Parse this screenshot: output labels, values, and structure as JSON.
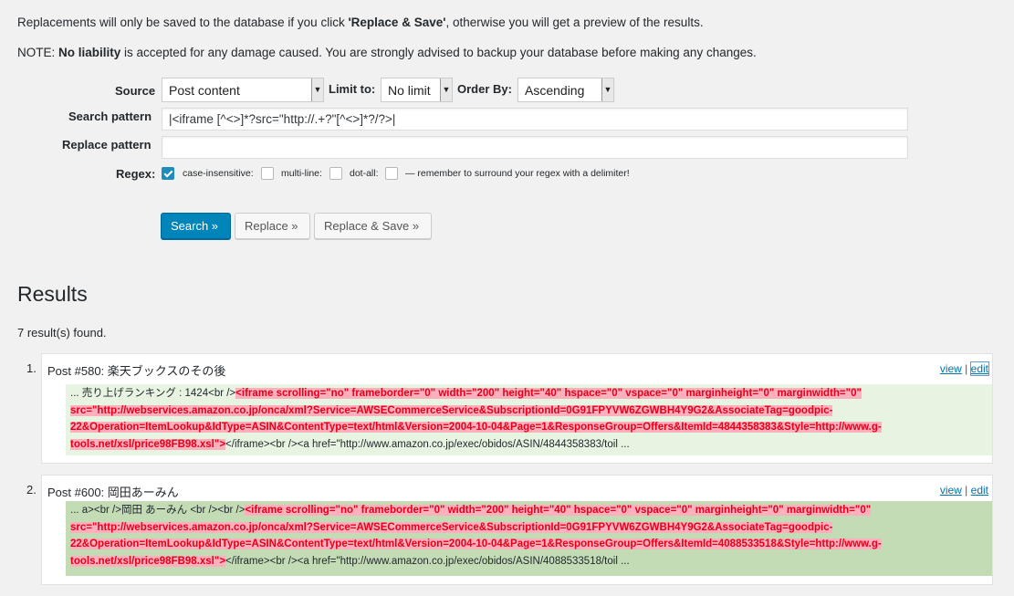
{
  "intro": {
    "line1_pre": "Replacements will only be saved to the database if you click ",
    "line1_bold": "'Replace & Save'",
    "line1_post": ", otherwise you will get a preview of the results.",
    "line2_pre": "NOTE: ",
    "line2_bold": "No liability",
    "line2_post": " is accepted for any damage caused. You are strongly advised to backup your database before making any changes."
  },
  "form": {
    "source_label": "Source",
    "source_value": "Post content",
    "limit_label": "Limit to:",
    "limit_value": "No limit",
    "order_label": "Order By:",
    "order_value": "Ascending",
    "search_label": "Search pattern",
    "search_value": "|<iframe [^<>]*?src=\"http://.+?\"[^<>]*?/?>|",
    "replace_label": "Replace pattern",
    "replace_value": "",
    "regex_label": "Regex:",
    "regex_checked": true,
    "case_insensitive_label": "case-insensitive:",
    "multi_line_label": "multi-line:",
    "dot_all_label": "dot-all:",
    "delimiter_note": "— remember to surround your regex with a delimiter!"
  },
  "buttons": {
    "search": "Search »",
    "replace": "Replace »",
    "replace_save": "Replace & Save »"
  },
  "results": {
    "heading": "Results",
    "count": "7 result(s) found.",
    "items": [
      {
        "num": "1.",
        "title": "Post #580: 楽天ブックスのその後",
        "view": "view",
        "sep": "|",
        "edit": "edit",
        "before": "... 売り上げランキング : 1424<br />",
        "match": "<iframe scrolling=\"no\" frameborder=\"0\" width=\"200\" height=\"40\" hspace=\"0\" vspace=\"0\" marginheight=\"0\" marginwidth=\"0\" src=\"http://webservices.amazon.co.jp/onca/xml?Service=AWSECommerceService&SubscriptionId=0G91FPYVW6ZGWBH4Y9G2&AssociateTag=goodpic-22&Operation=ItemLookup&IdType=ASIN&ContentType=text/html&Version=2004-10-04&Page=1&ResponseGroup=Offers&ItemId=4844358383&Style=http://www.g-tools.net/xsl/price98FB98.xsl\">",
        "after": "</iframe><br /><a href=\"http://www.amazon.co.jp/exec/obidos/ASIN/4844358383/toil ..."
      },
      {
        "num": "2.",
        "title": "Post #600: 岡田あーみん",
        "view": "view",
        "sep": "|",
        "edit": "edit",
        "before": "... a><br />岡田 あーみん <br /><br />",
        "match": "<iframe scrolling=\"no\" frameborder=\"0\" width=\"200\" height=\"40\" hspace=\"0\" vspace=\"0\" marginheight=\"0\" marginwidth=\"0\" src=\"http://webservices.amazon.co.jp/onca/xml?Service=AWSECommerceService&SubscriptionId=0G91FPYVW6ZGWBH4Y9G2&AssociateTag=goodpic-22&Operation=ItemLookup&IdType=ASIN&ContentType=text/html&Version=2004-10-04&Page=1&ResponseGroup=Offers&ItemId=4088533518&Style=http://www.g-tools.net/xsl/price98FB98.xsl\">",
        "after": "</iframe><br /><a href=\"http://www.amazon.co.jp/exec/obidos/ASIN/4088533518/toil ..."
      }
    ]
  },
  "colors": {
    "primary_button": "#0085ba",
    "match_text": "#e3001b",
    "match_bg": "#ffb0bc",
    "result_bg_light": "#e7f4e1",
    "result_bg_dark": "#c3dcb6",
    "link": "#0073aa"
  },
  "icons": {
    "dropdown": "chevron-down-icon",
    "checkbox": "checkmark-icon"
  }
}
